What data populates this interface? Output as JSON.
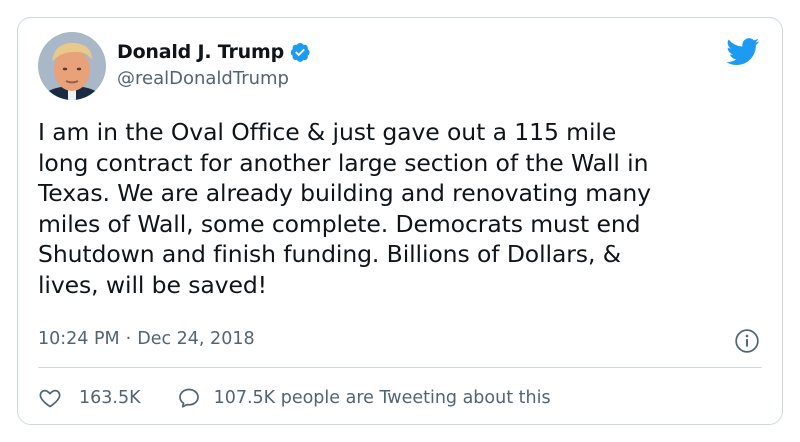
{
  "user": {
    "display_name": "Donald J. Trump",
    "handle": "@realDonaldTrump",
    "verified": true,
    "avatar_icon": "profile-photo"
  },
  "tweet": {
    "text": "I am in the Oval Office & just gave out a 115 mile\nlong contract for another large section of the Wall in\nTexas. We are already building and renovating many\nmiles of Wall, some complete. Democrats must end\nShutdown and finish funding. Billions of Dollars, &\nlives, will be saved!",
    "time": "10:24 PM",
    "separator": "·",
    "date": "Dec 24, 2018"
  },
  "actions": {
    "likes": "163.5K",
    "conversation": "107.5K people are Tweeting about this"
  },
  "colors": {
    "brand": "#1d9bf0",
    "text": "#0f1419",
    "secondary": "#536471",
    "border": "#cfd9de"
  },
  "icons": {
    "logo": "twitter-bird-icon",
    "verified": "verified-badge-icon",
    "info": "info-icon",
    "like": "heart-icon",
    "reply": "reply-bubble-icon"
  }
}
